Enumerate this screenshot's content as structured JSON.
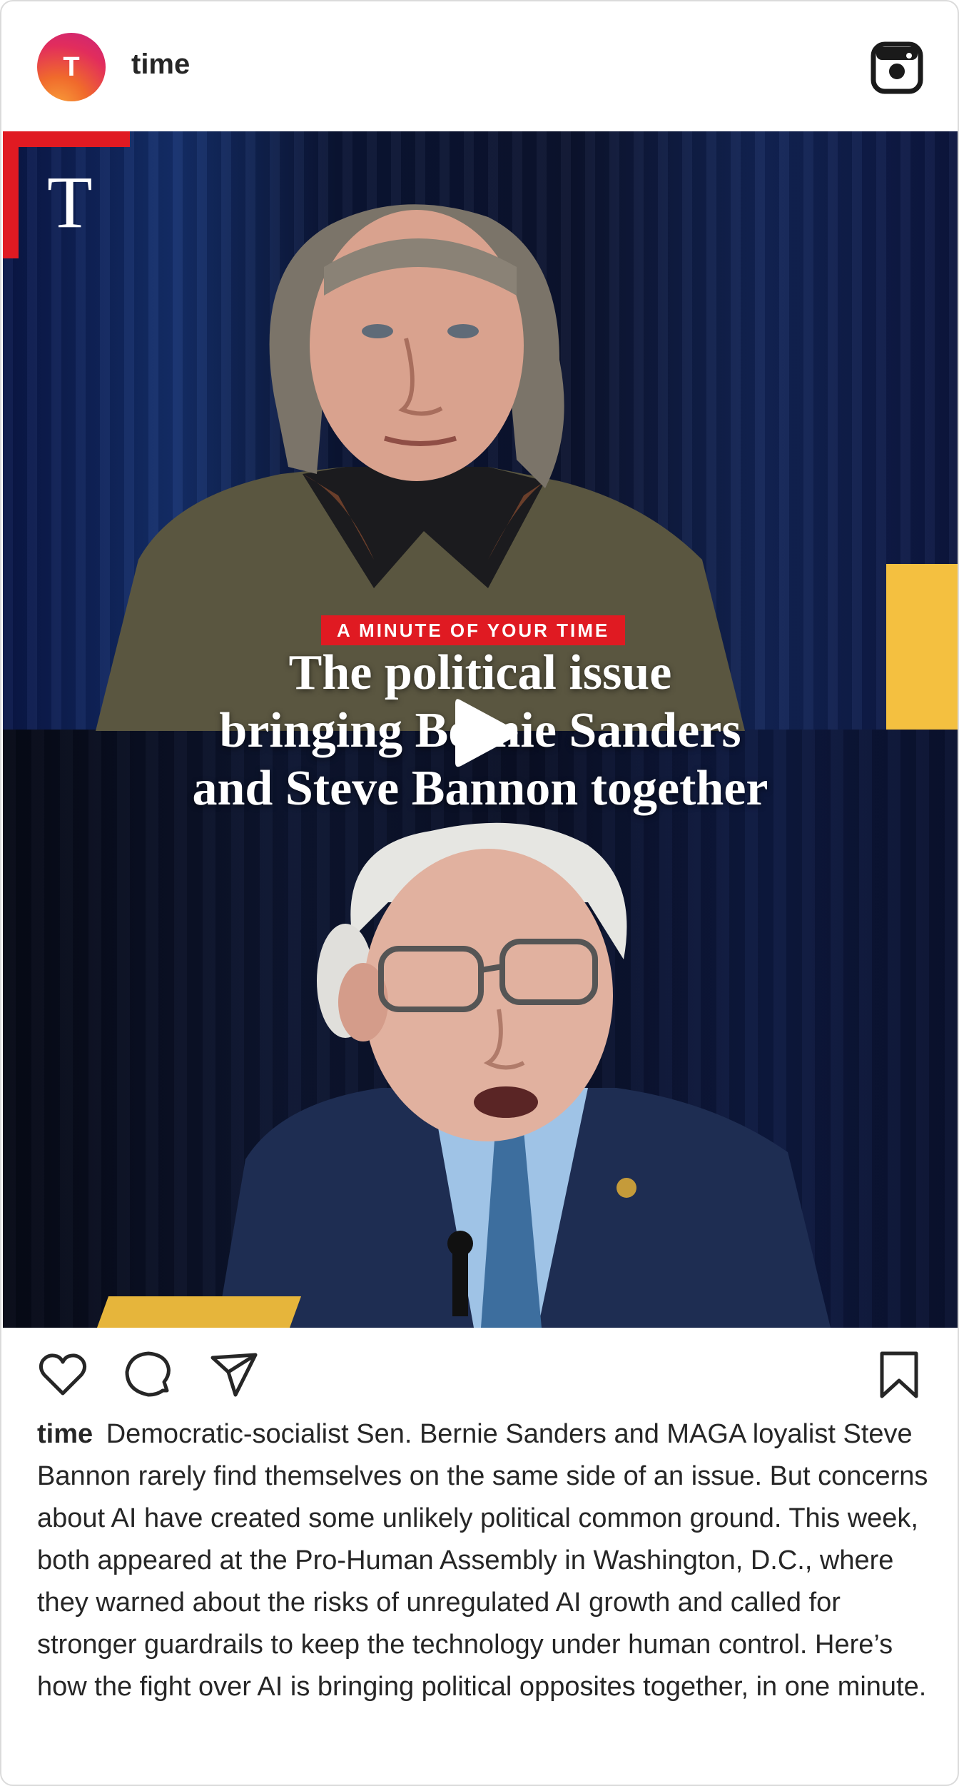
{
  "post": {
    "account": {
      "username": "time",
      "avatar_letter": "T"
    },
    "media": {
      "brand_mark": "T",
      "kicker": "A MINUTE OF YOUR TIME",
      "headline_lines": [
        "The political issue",
        "bringing Bernie Sanders",
        "and Steve Bannon together"
      ],
      "play_icon": "play-icon",
      "accent_color": "#e01a22"
    },
    "actions": {
      "like_icon": "heart-icon",
      "comment_icon": "comment-icon",
      "share_icon": "share-icon",
      "save_icon": "bookmark-icon"
    },
    "caption": {
      "username": "time",
      "text": "Democratic-socialist Sen. Bernie Sanders and MAGA loyalist Steve Bannon rarely find themselves on the same side of an issue. But concerns about AI have created some unlikely political common ground. This week, both appeared at the Pro-Human Assembly in Washington, D.C., where they warned about the risks of unregulated AI growth and called for stronger guardrails to keep the technology under human control. Here’s how the fight over AI is bringing political opposites together, in one minute."
    }
  }
}
